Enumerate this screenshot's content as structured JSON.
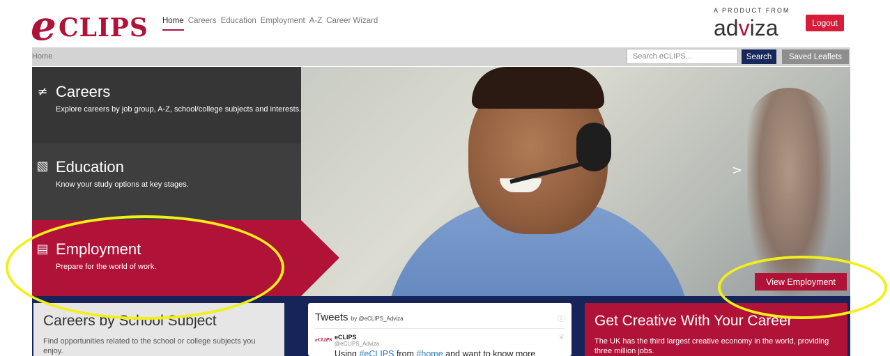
{
  "header": {
    "logo": {
      "mark": "e",
      "text": "CLIPS"
    },
    "nav": [
      "Home",
      "Careers",
      "Education",
      "Employment",
      "A-Z",
      "Career Wizard"
    ],
    "product_from": "A PRODUCT FROM",
    "brand": {
      "pre": "ad",
      "v": "v",
      "post": "iza"
    },
    "logout_label": "Logout"
  },
  "breadcrumb": {
    "home": "Home"
  },
  "search": {
    "placeholder": "Search eCLIPS...",
    "button_label": "Search"
  },
  "saved_leaflets_label": "Saved Leaflets",
  "hero": {
    "careers": {
      "title": "Careers",
      "desc": "Explore careers by job group, A-Z, school/college subjects and interests."
    },
    "education": {
      "title": "Education",
      "desc": "Know your study options at key stages."
    },
    "employment": {
      "title": "Employment",
      "desc": "Prepare for the world of work."
    },
    "view_button": "View Employment",
    "next_arrow": ">"
  },
  "cards": {
    "subject": {
      "title": "Careers by School Subject",
      "desc": "Find opportunities related to the school or college subjects you enjoy."
    },
    "tweets": {
      "title": "Tweets",
      "by": "by @eCLIPS_Adviza",
      "avatar_text": "eCLIPS",
      "name": "eCLIPS",
      "handle": "@eCLIPS_Adviza",
      "text_pre": "Using ",
      "link1": "#eCLIPS",
      "text_mid": " from ",
      "link2": "#home",
      "text_post": " and want to know more"
    },
    "creative": {
      "title": "Get Creative With Your Career",
      "desc": "The UK has the third largest creative economy in the world, providing three million jobs."
    }
  },
  "colors": {
    "brand": "#b01238",
    "navy": "#17245a",
    "search_button": "#18285a",
    "highlight": "#f2ef18"
  },
  "icons": {
    "careers": "signpost-icon",
    "education": "book-icon",
    "employment": "briefcase-icon",
    "info": "info-icon",
    "twitter": "bird-icon"
  }
}
